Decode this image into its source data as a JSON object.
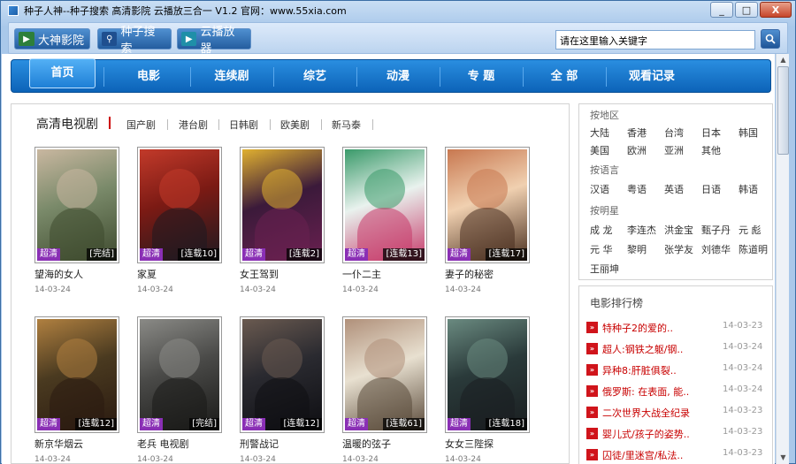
{
  "window": {
    "title": "种子人神--种子搜索 高清影院 云播放三合一  V1.2  官网：www.55xia.com",
    "controls": [
      "_",
      "□",
      "X"
    ]
  },
  "toolbar": {
    "buttons": [
      {
        "label": "大神影院",
        "icon": "clapperboard-icon"
      },
      {
        "label": "种子搜索",
        "icon": "search-icon"
      },
      {
        "label": "云播放器",
        "icon": "play-icon"
      }
    ],
    "search_placeholder": "请在这里输入关键字"
  },
  "nav": {
    "items": [
      "首页",
      "电影",
      "连续剧",
      "综艺",
      "动漫",
      "专 题",
      "全 部",
      "观看记录"
    ],
    "active": "首页"
  },
  "section": {
    "title": "高清电视剧",
    "tabs": [
      "国产剧",
      "港台剧",
      "日韩剧",
      "欧美剧",
      "新马泰"
    ]
  },
  "movies": [
    {
      "name": "望海的女人",
      "date": "14-03-24",
      "badge": "超清",
      "status": "[完结]",
      "colors": [
        "#7a8a6a",
        "#c9b7a0",
        "#3e4a2e"
      ]
    },
    {
      "name": "家夏",
      "date": "14-03-24",
      "badge": "超清",
      "status": "[连载10]",
      "colors": [
        "#7b1a14",
        "#c23a2a",
        "#1e1a20"
      ]
    },
    {
      "name": "女王驾到",
      "date": "14-03-24",
      "badge": "超清",
      "status": "[连载2]",
      "colors": [
        "#3b1a3a",
        "#e0b030",
        "#6a2050"
      ]
    },
    {
      "name": "一仆二主",
      "date": "14-03-24",
      "badge": "超清",
      "status": "[连载13]",
      "colors": [
        "#e9f2ee",
        "#3a9a6a",
        "#c73a6a"
      ]
    },
    {
      "name": "妻子的秘密",
      "date": "14-03-24",
      "badge": "超清",
      "status": "[连载17]",
      "colors": [
        "#f0d0b0",
        "#c87850",
        "#4a3020"
      ]
    },
    {
      "name": "新京华烟云",
      "date": "14-03-24",
      "badge": "超清",
      "status": "[连载12]",
      "colors": [
        "#4a3a20",
        "#b08040",
        "#2a1a10"
      ]
    },
    {
      "name": "老兵 电视剧",
      "date": "14-03-24",
      "badge": "超清",
      "status": "[完结]",
      "colors": [
        "#4a4a48",
        "#8a8a86",
        "#1a1a18"
      ]
    },
    {
      "name": "刑警战记",
      "date": "14-03-24",
      "badge": "超清",
      "status": "[连载12]",
      "colors": [
        "#2a2a30",
        "#6a5a50",
        "#0e0e12"
      ]
    },
    {
      "name": "温暖的弦子",
      "date": "14-03-24",
      "badge": "超清",
      "status": "[连载61]",
      "colors": [
        "#e8e0d0",
        "#b0907a",
        "#5a4a3a"
      ]
    },
    {
      "name": "女女三陛探",
      "date": "14-03-24",
      "badge": "超清",
      "status": "[连载18]",
      "colors": [
        "#2a3a3a",
        "#6a8a80",
        "#1a1e20"
      ]
    }
  ],
  "side": {
    "region_label": "按地区",
    "regions": [
      "大陆",
      "香港",
      "台湾",
      "日本",
      "韩国",
      "美国",
      "欧洲",
      "亚洲",
      "其他"
    ],
    "language_label": "按语言",
    "languages": [
      "汉语",
      "粤语",
      "英语",
      "日语",
      "韩语"
    ],
    "star_label": "按明星",
    "stars": [
      "成 龙",
      "李连杰",
      "洪金宝",
      "甄子丹",
      "元 彪",
      "元 华",
      "黎明",
      "张学友",
      "刘德华",
      "陈道明",
      "王丽坤"
    ]
  },
  "rank": {
    "title": "电影排行榜",
    "items": [
      {
        "name": "特种子2的爱的..",
        "date": "14-03-23"
      },
      {
        "name": "超人:钢铁之躯/钢..",
        "date": "14-03-24"
      },
      {
        "name": "异种8:肝脏俱裂..",
        "date": "14-03-24"
      },
      {
        "name": "俄罗斯: 在表面, 能..",
        "date": "14-03-24"
      },
      {
        "name": "二次世界大战全纪录",
        "date": "14-03-23"
      },
      {
        "name": "婴儿式/孩子的姿势..",
        "date": "14-03-23"
      },
      {
        "name": "囚徒/里迷宫/私法..",
        "date": "14-03-23"
      }
    ]
  }
}
